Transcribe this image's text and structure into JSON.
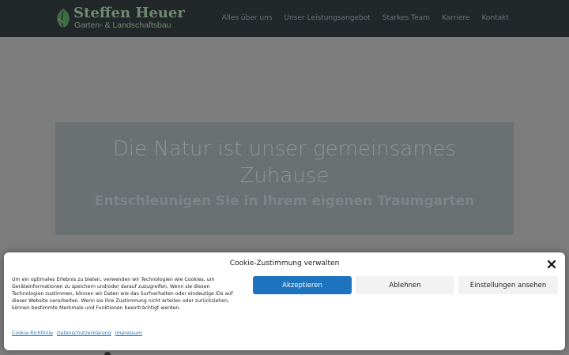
{
  "brand": {
    "name": "Steffen Heuer",
    "tagline": "Garten- & Landschaftsbau"
  },
  "nav": {
    "items": [
      {
        "label": "Alles über uns"
      },
      {
        "label": "Unser Leistungsangebot"
      },
      {
        "label": "Starkes Team"
      },
      {
        "label": "Karriere"
      },
      {
        "label": "Kontakt"
      }
    ]
  },
  "hero": {
    "title": "Die Natur ist unser gemeinsames Zuhause",
    "subtitle": "Entschleunigen Sie in Ihrem eigenen Traumgarten"
  },
  "cookie": {
    "title": "Cookie-Zustimmung verwalten",
    "text": "Um ein optimales Erlebnis zu bieten, verwenden wir Technologien wie Cookies, um Geräteinformationen zu speichern und/oder darauf zuzugreifen. Wenn sie diesen Technologien zustimmen, können wir Daten wie das Surfverhalten oder eindeutige IDs auf dieser Website verarbeiten. Wenn sie ihre Zustimmung nicht erteilen oder zurückziehen, können bestimmte Merkmale und Funktionen beeinträchtigt werden.",
    "accept_label": "Akzeptieren",
    "deny_label": "Ablehnen",
    "settings_label": "Einstellungen ansehen",
    "links": [
      {
        "label": "Cookie-Richtlinie"
      },
      {
        "label": "Datenschutzerklärung"
      },
      {
        "label": "Impressum"
      }
    ]
  },
  "colors": {
    "header_bg": "#22272a",
    "accent": "#1e73be",
    "brand_green": "#6f8a73"
  }
}
